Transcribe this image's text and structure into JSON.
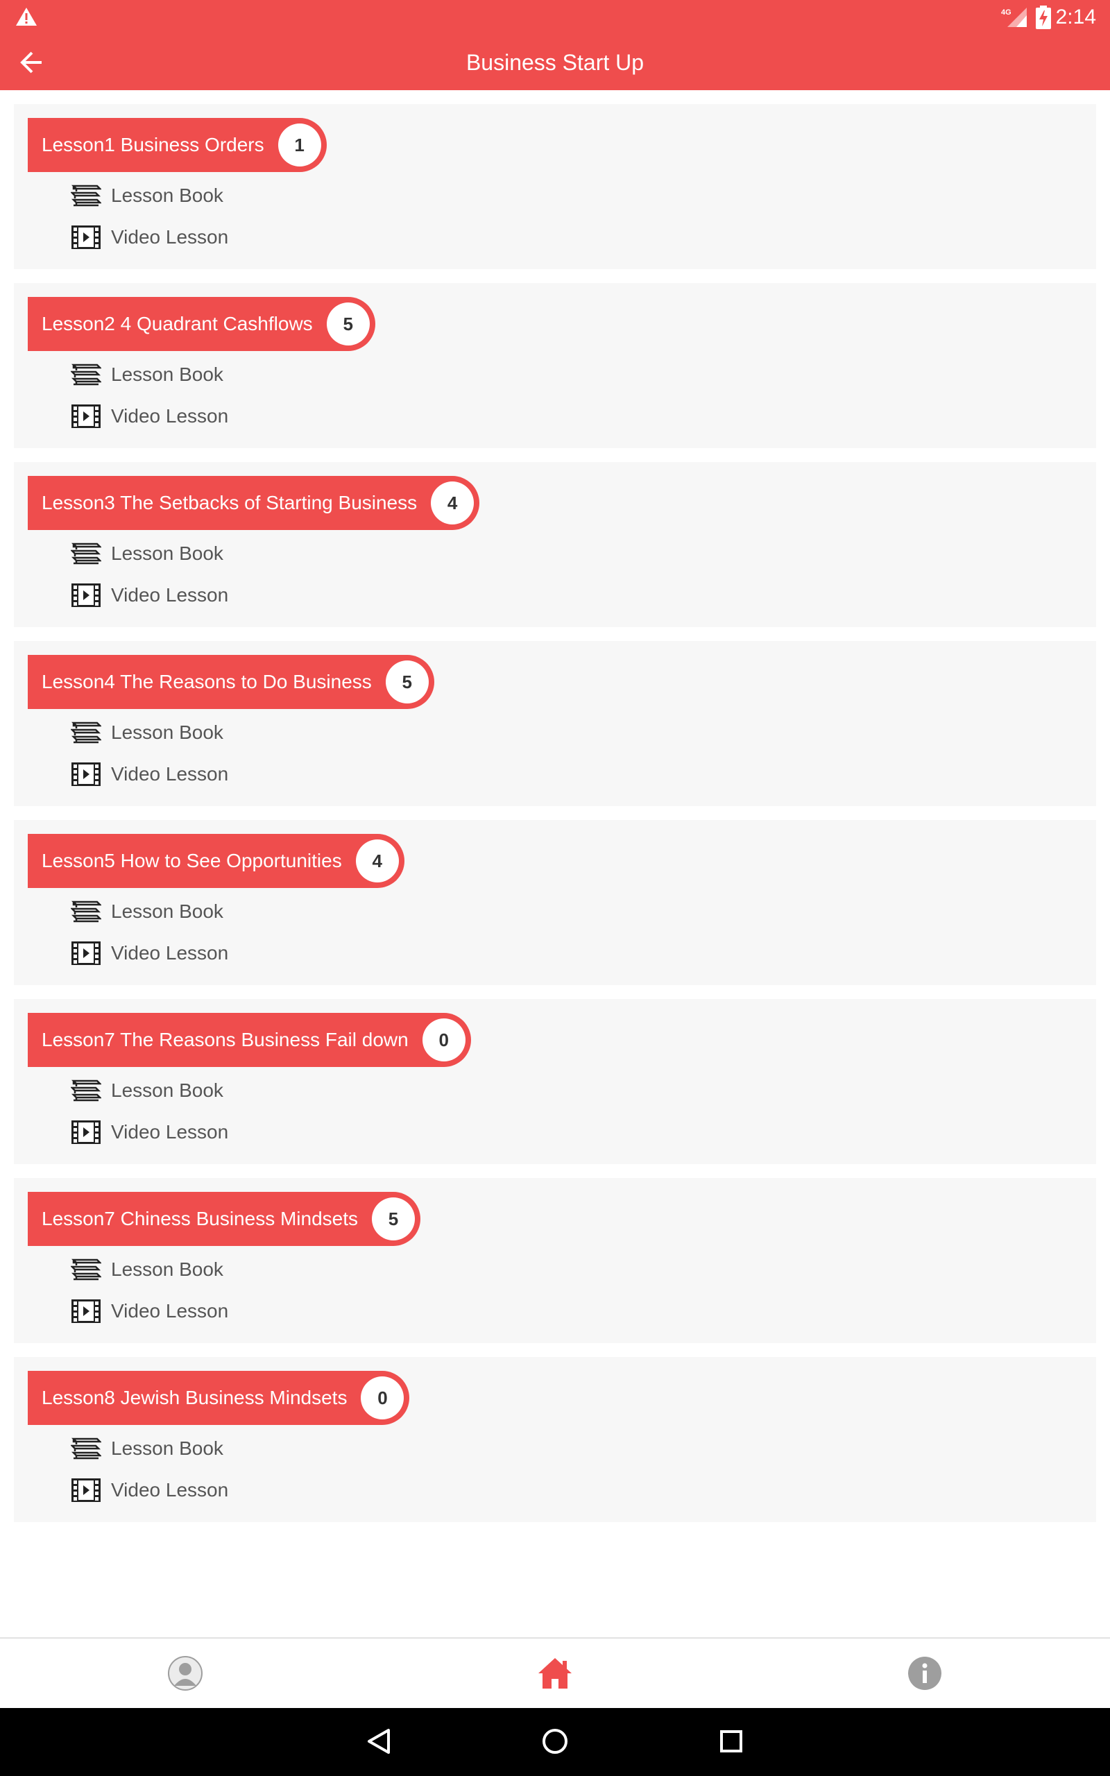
{
  "status_bar": {
    "time": "2:14",
    "network": "4G",
    "icons": [
      "warning-icon",
      "signal-icon",
      "battery-charging-icon"
    ]
  },
  "app_bar": {
    "title": "Business Start Up",
    "back_icon": "arrow-left-icon"
  },
  "lessons": [
    {
      "title": "Lesson1 Business Orders",
      "count": "1",
      "book_label": "Lesson Book",
      "video_label": "Video Lesson"
    },
    {
      "title": "Lesson2 4 Quadrant Cashflows",
      "count": "5",
      "book_label": "Lesson Book",
      "video_label": "Video Lesson"
    },
    {
      "title": "Lesson3 The Setbacks of Starting Business",
      "count": "4",
      "book_label": "Lesson Book",
      "video_label": "Video Lesson"
    },
    {
      "title": "Lesson4 The Reasons to Do Business",
      "count": "5",
      "book_label": "Lesson Book",
      "video_label": "Video Lesson"
    },
    {
      "title": "Lesson5 How to See Opportunities",
      "count": "4",
      "book_label": "Lesson Book",
      "video_label": "Video Lesson"
    },
    {
      "title": "Lesson7 The Reasons Business Fail down",
      "count": "0",
      "book_label": "Lesson Book",
      "video_label": "Video Lesson"
    },
    {
      "title": "Lesson7 Chiness Business Mindsets",
      "count": "5",
      "book_label": "Lesson Book",
      "video_label": "Video Lesson"
    },
    {
      "title": "Lesson8 Jewish Business Mindsets",
      "count": "0",
      "book_label": "Lesson Book",
      "video_label": "Video Lesson"
    }
  ],
  "bottom_nav": {
    "tabs": [
      {
        "icon": "profile-icon",
        "active": false
      },
      {
        "icon": "home-icon",
        "active": true
      },
      {
        "icon": "info-icon",
        "active": false
      }
    ]
  },
  "system_nav": {
    "buttons": [
      "back-triangle-icon",
      "home-circle-icon",
      "recents-square-icon"
    ]
  },
  "colors": {
    "accent": "#ef4d4d",
    "card_background": "#f7f7f7",
    "item_text": "#555555",
    "inactive_icon": "#9e9e9e"
  }
}
